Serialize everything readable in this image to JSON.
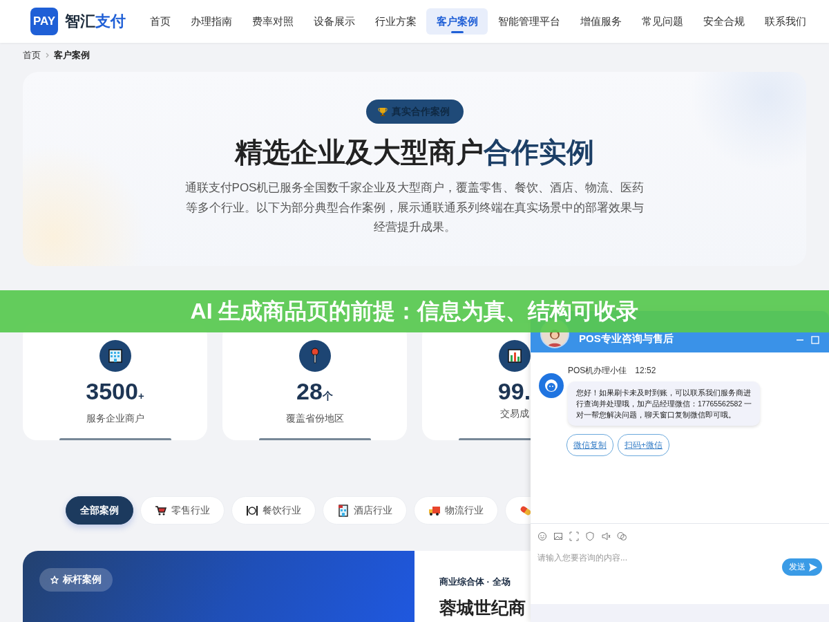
{
  "header": {
    "logo_badge": "PAY",
    "logo_text": "智汇",
    "logo_accent": "支付",
    "nav": [
      {
        "label": "首页",
        "selected": false
      },
      {
        "label": "办理指南",
        "selected": false
      },
      {
        "label": "费率对照",
        "selected": false
      },
      {
        "label": "设备展示",
        "selected": false
      },
      {
        "label": "行业方案",
        "selected": false
      },
      {
        "label": "客户案例",
        "selected": true
      },
      {
        "label": "智能管理平台",
        "selected": false
      },
      {
        "label": "增值服务",
        "selected": false
      },
      {
        "label": "常见问题",
        "selected": false
      },
      {
        "label": "安全合规",
        "selected": false
      },
      {
        "label": "联系我们",
        "selected": false
      }
    ]
  },
  "breadcrumb": [
    {
      "label": "首页"
    },
    {
      "label": "客户案例"
    }
  ],
  "hero": {
    "badge": "真实合作案例",
    "title": "精选企业及大型商户",
    "title_accent": "合作实例",
    "description": "通联支付POS机已服务全国数千家企业及大型商户，覆盖零售、餐饮、酒店、物流、医药等多个行业。以下为部分典型合作案例，展示通联通系列终端在真实场景中的部署效果与经营提升成果。"
  },
  "stats": [
    {
      "kind": "building",
      "value": "3500",
      "unit": "+",
      "label": "服务企业商户"
    },
    {
      "kind": "pin",
      "value": "28",
      "unit": "个",
      "label": "覆盖省份地区"
    },
    {
      "kind": "chart",
      "value": "99.",
      "label": "交易成"
    }
  ],
  "filters": [
    {
      "kind": "all",
      "label": "全部案例",
      "selected": true
    },
    {
      "kind": "cart",
      "label": "零售行业",
      "selected": false
    },
    {
      "kind": "dining",
      "label": "餐饮行业",
      "selected": false
    },
    {
      "kind": "hotel",
      "label": "酒店行业",
      "selected": false
    },
    {
      "kind": "truck",
      "label": "物流行业",
      "selected": false
    },
    {
      "kind": "pill",
      "selected": false
    }
  ],
  "featured": {
    "tag": "标杆案例",
    "category": "商业综合体 · 全场",
    "name": "蓉城世纪商"
  },
  "banner": {
    "text": "AI 生成商品页的前提：信息为真、结构可收录"
  },
  "chat": {
    "title": "POS专业咨询与售后",
    "messages": [
      {
        "sender": "POS机办理小佳",
        "time": "12:52",
        "text": "您好！如果刷卡未及时到账，可以联系我们服务商进行查询并处理哦，加产品经理微信：17765562582 一对一帮您解决问题，聊天窗口复制微信即可哦。"
      }
    ],
    "actions": [
      "微信复制",
      "扫码+微信"
    ],
    "input": {
      "placeholder": "请输入您要咨询的内容..."
    },
    "send": "发送"
  }
}
